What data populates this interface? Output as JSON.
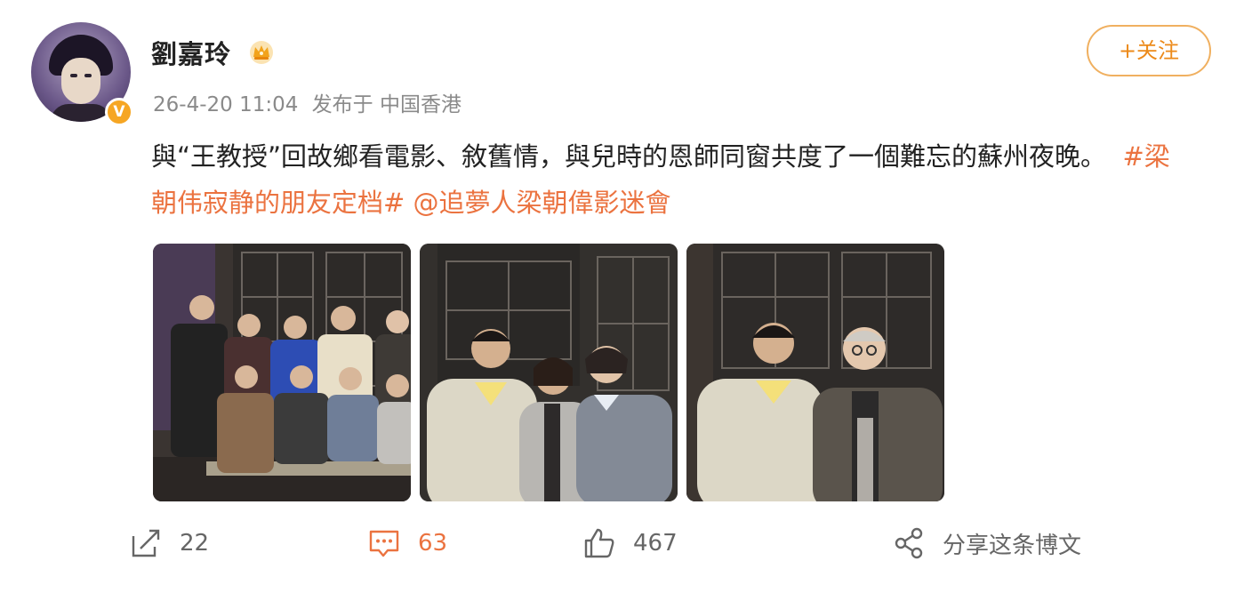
{
  "user": {
    "name": "劉嘉玲",
    "verified_badge": "V",
    "timestamp": "26-4-20 11:04",
    "source": "发布于 中国香港"
  },
  "follow_button": {
    "label": "+关注"
  },
  "post": {
    "text_part1": "與“王教授”回故鄉看電影、敘舊情，與兒時的恩師同窗共度了一個難忘的蘇州夜晚。",
    "hashtag": "#梁朝伟寂静的朋友定档#",
    "mention": "@追夢人梁朝偉影迷會"
  },
  "actions": {
    "share_count": "22",
    "comment_count": "63",
    "like_count": "467",
    "share_post_label": "分享这条博文"
  },
  "colors": {
    "accent": "#eb7340",
    "follow_border": "#f0b060",
    "meta_gray": "#8a8a8a",
    "badge": "#f6a623"
  },
  "icons": [
    "verified-badge-icon",
    "crown-icon",
    "repost-icon",
    "comment-icon",
    "like-icon",
    "share-icon"
  ]
}
